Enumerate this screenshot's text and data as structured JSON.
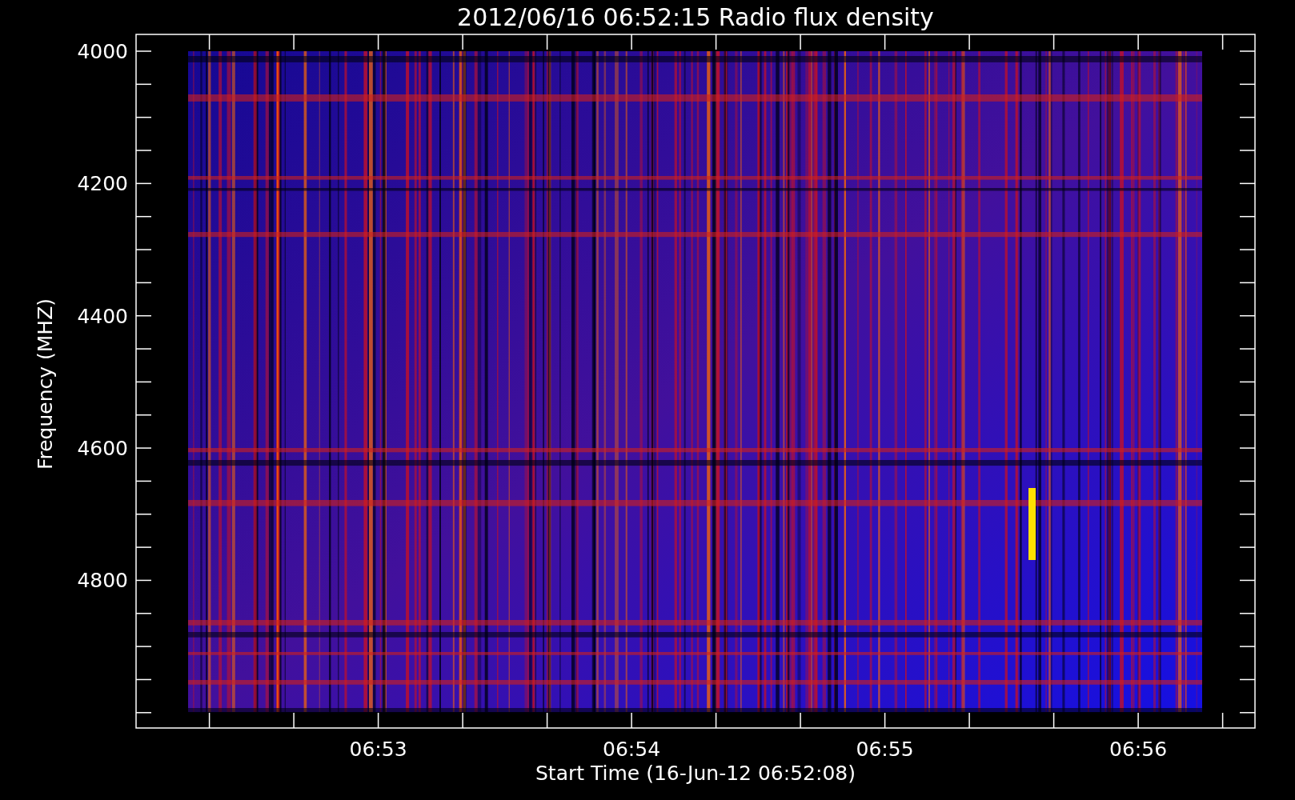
{
  "plot": {
    "title": "2012/06/16 06:52:15 Radio flux density",
    "xlabel": "Start Time (16-Jun-12 06:52:08)",
    "ylabel": "Frequency (MHZ)",
    "xticks": [
      "06:53",
      "06:54",
      "06:55",
      "06:56"
    ],
    "yticks": [
      "4000",
      "4200",
      "4400",
      "4600",
      "4800"
    ]
  }
}
